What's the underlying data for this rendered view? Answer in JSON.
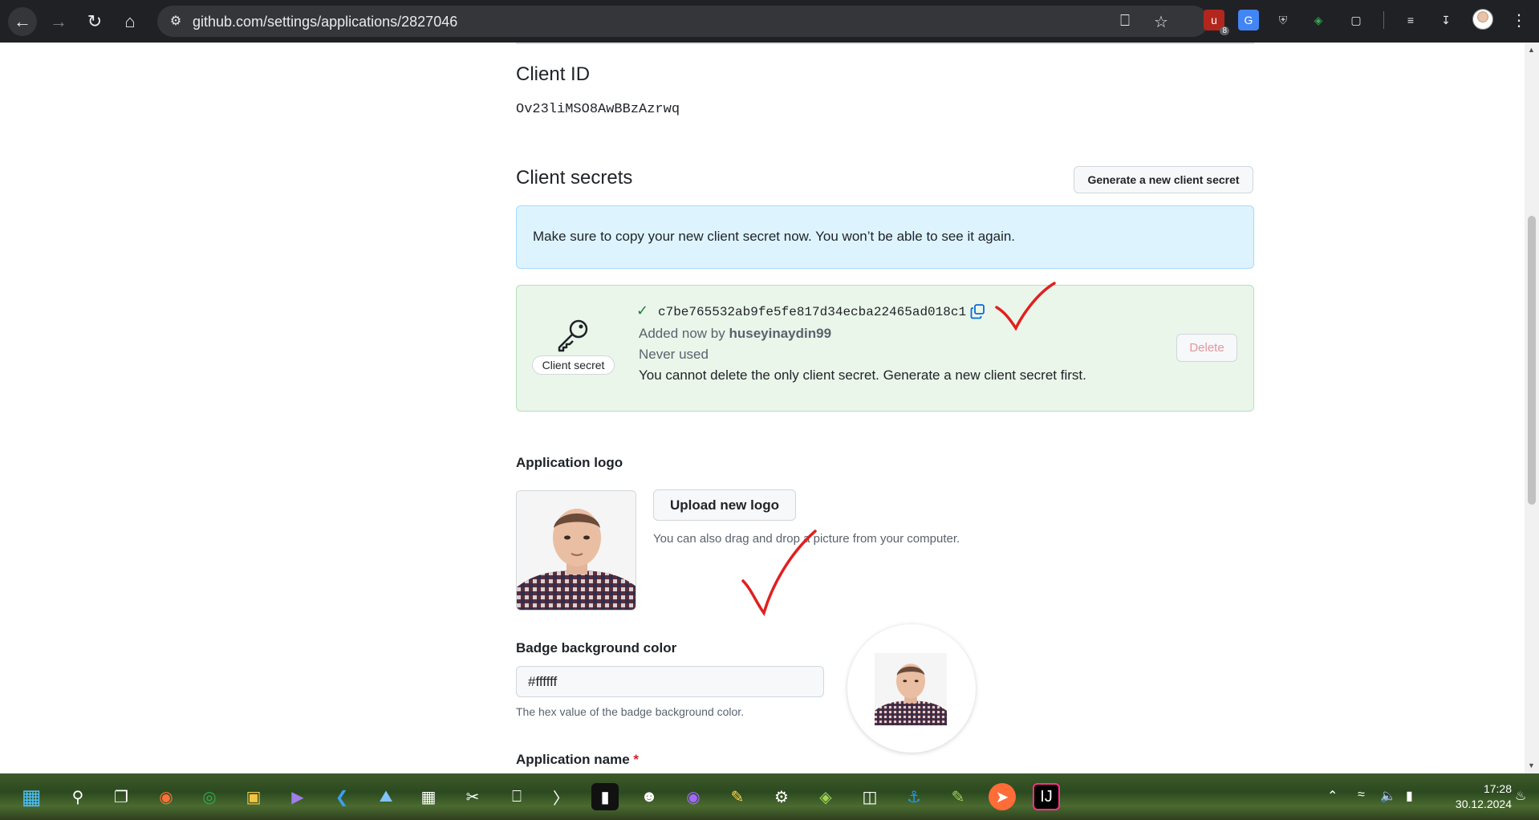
{
  "browser": {
    "url": "github.com/settings/applications/2827046",
    "extension_badge": "8"
  },
  "client_id": {
    "heading": "Client ID",
    "value": "Ov23liMSO8AwBBzAzrwq"
  },
  "client_secrets": {
    "heading": "Client secrets",
    "generate_button": "Generate a new client secret",
    "flash_message": "Make sure to copy your new client secret now. You won’t be able to see it again.",
    "secret": {
      "icon_label": "Client secret",
      "value": "c7be765532ab9fe5fe817d34ecba22465ad018c1",
      "added_prefix": "Added now by ",
      "added_by": "huseyinaydin99",
      "usage": "Never used",
      "warning": "You cannot delete the only client secret. Generate a new client secret first.",
      "delete_button": "Delete"
    }
  },
  "application_logo": {
    "heading": "Application logo",
    "upload_button": "Upload new logo",
    "hint": "You can also drag and drop a picture from your computer."
  },
  "badge": {
    "heading": "Badge background color",
    "value": "#ffffff",
    "hint": "The hex value of the badge background color."
  },
  "application_name": {
    "heading": "Application name",
    "required_mark": "*"
  },
  "taskbar": {
    "time": "17:28",
    "date": "30.12.2024"
  },
  "colors": {
    "annotation_red": "#e02020",
    "flash_bg": "#ddf4ff",
    "secret_bg": "#eaf6ea"
  }
}
